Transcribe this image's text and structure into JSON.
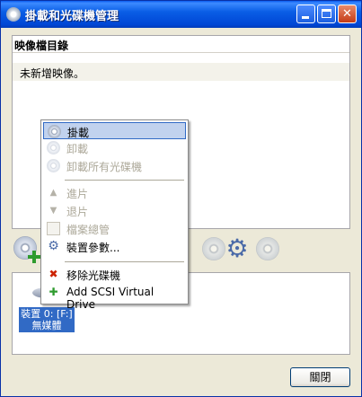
{
  "window": {
    "title": "掛載和光碟機管理",
    "icon": "disc-icon",
    "controls": [
      "minimize-icon",
      "maximize-icon",
      "close-icon"
    ],
    "close_glyph": "✕"
  },
  "image_list": {
    "header": "映像檔目錄",
    "empty_text": "未新增映像。"
  },
  "toolbar": {
    "icons": [
      "add-disc-icon",
      "disc-icon",
      "settings-gear-icon",
      "disc-icon"
    ],
    "gear_glyph": "⚙"
  },
  "devices": [
    {
      "line1": "裝置 0: [F:]",
      "line2": "無媒體"
    }
  ],
  "context_menu": {
    "items": [
      {
        "label": "掛載",
        "enabled": true,
        "highlighted": true,
        "icon": "mount-disc-icon"
      },
      {
        "label": "卸載",
        "enabled": false,
        "icon": "unmount-disc-icon"
      },
      {
        "label": "卸載所有光碟機",
        "enabled": false,
        "icon": "unmount-all-icon"
      },
      {
        "label": "進片",
        "enabled": false,
        "icon": "eject-up-icon"
      },
      {
        "label": "退片",
        "enabled": false,
        "icon": "eject-down-icon"
      },
      {
        "label": "檔案總管",
        "enabled": false,
        "icon": "explorer-icon"
      },
      {
        "label": "裝置參數...",
        "enabled": true,
        "icon": "gear-icon"
      },
      {
        "label": "移除光碟機",
        "enabled": true,
        "icon": "remove-drive-icon"
      },
      {
        "label": "Add SCSI Virtual Drive",
        "enabled": true,
        "icon": "add-drive-icon"
      }
    ],
    "glyphs": {
      "up": "▲",
      "down": "▼",
      "gear": "⚙",
      "remove": "✖",
      "add": "✚"
    }
  },
  "footer": {
    "close_button": "關閉"
  }
}
